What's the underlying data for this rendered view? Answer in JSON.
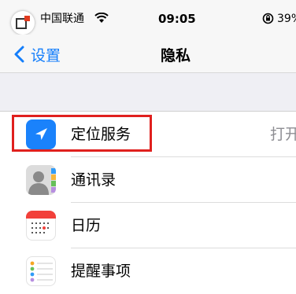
{
  "status_bar": {
    "carrier": "中国联通",
    "time": "09:05",
    "battery": "39%"
  },
  "nav": {
    "back_label": "设置",
    "title": "隐私"
  },
  "rows": [
    {
      "label": "定位服务",
      "value": "打开",
      "icon": "location-arrow-icon",
      "highlighted": true
    },
    {
      "label": "通讯录",
      "icon": "contacts-icon"
    },
    {
      "label": "日历",
      "icon": "calendar-icon"
    },
    {
      "label": "提醒事项",
      "icon": "reminders-icon"
    }
  ],
  "colors": {
    "accent": "#147efb",
    "location_icon_bg": "#1a82fb",
    "highlight": "#e0201e",
    "group_bg": "#efeff4"
  }
}
